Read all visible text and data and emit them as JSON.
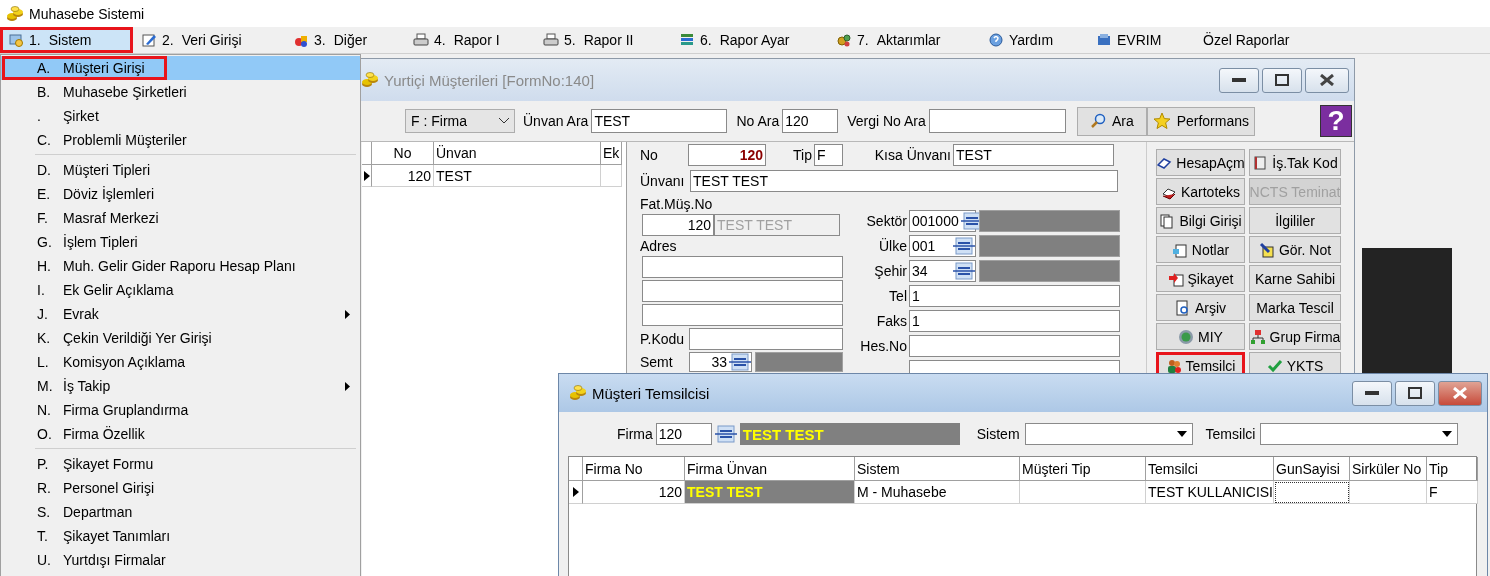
{
  "app": {
    "title": "Muhasebe Sistemi"
  },
  "menu_bar": [
    {
      "number": "1.",
      "label": "Sistem",
      "selected": true,
      "highlighted": true
    },
    {
      "number": "2.",
      "label": "Veri Girişi",
      "selected": false,
      "highlighted": false
    },
    {
      "number": "3.",
      "label": "Diğer",
      "selected": false,
      "highlighted": false
    },
    {
      "number": "4.",
      "label": "Rapor I",
      "selected": false,
      "highlighted": false
    },
    {
      "number": "5.",
      "label": "Rapor II",
      "selected": false,
      "highlighted": false
    },
    {
      "number": "6.",
      "label": "Rapor Ayar",
      "selected": false,
      "highlighted": false
    },
    {
      "number": "7.",
      "label": "Aktarımlar",
      "selected": false,
      "highlighted": false
    },
    {
      "label": "Yardım",
      "selected": false,
      "highlighted": false
    },
    {
      "label": "EVRIM",
      "selected": false,
      "highlighted": false
    },
    {
      "label": "Özel Raporlar",
      "selected": false,
      "highlighted": false
    }
  ],
  "menu_dropdown": {
    "groups": [
      {
        "items": [
          {
            "key": "A.",
            "label": "Müşteri Girişi",
            "selected": true,
            "highlighted": true,
            "submenu": false
          },
          {
            "key": "B.",
            "label": "Muhasebe Şirketleri",
            "selected": false,
            "highlighted": false,
            "submenu": false
          },
          {
            "key": ".",
            "label": "Şirket",
            "selected": false,
            "highlighted": false,
            "submenu": false
          },
          {
            "key": "C.",
            "label": "Problemli Müşteriler",
            "selected": false,
            "highlighted": false,
            "submenu": false
          }
        ]
      },
      {
        "items": [
          {
            "key": "D.",
            "label": "Müşteri Tipleri",
            "selected": false,
            "highlighted": false,
            "submenu": false
          },
          {
            "key": "E.",
            "label": "Döviz İşlemleri",
            "selected": false,
            "highlighted": false,
            "submenu": false
          },
          {
            "key": "F.",
            "label": "Masraf Merkezi",
            "selected": false,
            "highlighted": false,
            "submenu": false
          },
          {
            "key": "G.",
            "label": "İşlem Tipleri",
            "selected": false,
            "highlighted": false,
            "submenu": false
          },
          {
            "key": "H.",
            "label": "Muh. Gelir Gider Raporu Hesap Planı",
            "selected": false,
            "highlighted": false,
            "submenu": false
          },
          {
            "key": "I.",
            "label": "Ek Gelir Açıklama",
            "selected": false,
            "highlighted": false,
            "submenu": false
          },
          {
            "key": "J.",
            "label": "Evrak",
            "selected": false,
            "highlighted": false,
            "submenu": true
          },
          {
            "key": "K.",
            "label": "Çekin Verildiği Yer Girişi",
            "selected": false,
            "highlighted": false,
            "submenu": false
          },
          {
            "key": "L.",
            "label": "Komisyon Açıklama",
            "selected": false,
            "highlighted": false,
            "submenu": false
          },
          {
            "key": "M.",
            "label": "İş Takip",
            "selected": false,
            "highlighted": false,
            "submenu": true
          },
          {
            "key": "N.",
            "label": "Firma Gruplandırma",
            "selected": false,
            "highlighted": false,
            "submenu": false
          },
          {
            "key": "O.",
            "label": "Firma Özellik",
            "selected": false,
            "highlighted": false,
            "submenu": false
          }
        ]
      },
      {
        "items": [
          {
            "key": "P.",
            "label": "Şikayet Formu",
            "selected": false,
            "highlighted": false,
            "submenu": false
          },
          {
            "key": "R.",
            "label": "Personel Girişi",
            "selected": false,
            "highlighted": false,
            "submenu": false
          },
          {
            "key": "S.",
            "label": "Departman",
            "selected": false,
            "highlighted": false,
            "submenu": false
          },
          {
            "key": "T.",
            "label": "Şikayet Tanımları",
            "selected": false,
            "highlighted": false,
            "submenu": false
          },
          {
            "key": "U.",
            "label": "Yurtdışı Firmalar",
            "selected": false,
            "highlighted": false,
            "submenu": false
          }
        ]
      }
    ]
  },
  "customer_window": {
    "title": "Yurtiçi Müşterileri [FormNo:140]",
    "active": false,
    "type_select": "F : Firma",
    "search_fields": [
      {
        "label": "Ünvan Ara",
        "value": "TEST"
      },
      {
        "label": "No Ara",
        "value": "120"
      },
      {
        "label": "Vergi No Ara"
      }
    ],
    "buttons": [
      "Ara",
      "Performans"
    ],
    "help": "?",
    "list": {
      "columns": [
        "No",
        "Ünvan",
        "Ek"
      ],
      "rows": [
        {
          "no": "120",
          "unvan": "TEST",
          "selected": true
        }
      ]
    },
    "form": {
      "no": {
        "label": "No",
        "value": "120"
      },
      "tip": {
        "label": "Tip",
        "value": "F"
      },
      "kisa_unvani": {
        "label": "Kısa Ünvanı",
        "value": "TEST"
      },
      "unvani": {
        "label": "Ünvanı",
        "value": "TEST TEST"
      },
      "fat_mus_no": {
        "label": "Fat.Müş.No",
        "value": "120",
        "name": "TEST TEST"
      },
      "adres": {
        "label": "Adres"
      },
      "p_kodu": {
        "label": "P.Kodu"
      },
      "semt": {
        "label": "Semt",
        "value": "33"
      },
      "right_fields": [
        {
          "kind": "lookup",
          "label": "Sektör",
          "value": "001000"
        },
        {
          "kind": "lookup",
          "label": "Ülke",
          "value": "001"
        },
        {
          "kind": "lookup",
          "label": "Şehir",
          "value": "34"
        },
        {
          "kind": "text",
          "label": "Tel",
          "value": "1"
        },
        {
          "kind": "text",
          "label": "Faks",
          "value": "1"
        },
        {
          "kind": "text",
          "label": "Hes.No"
        },
        {
          "kind": "text"
        }
      ]
    },
    "side_buttons": [
      {
        "label": "HesapAçm",
        "disabled": false,
        "highlighted": false
      },
      {
        "label": "İş.Tak Kod",
        "disabled": false,
        "highlighted": false
      },
      {
        "label": "Kartoteks",
        "disabled": false,
        "highlighted": false
      },
      {
        "label": "NCTS Teminat",
        "disabled": true,
        "highlighted": false
      },
      {
        "label": "Bilgi Girişi",
        "disabled": false,
        "highlighted": false
      },
      {
        "label": "İlgililer",
        "disabled": false,
        "highlighted": false
      },
      {
        "label": "Notlar",
        "disabled": false,
        "highlighted": false
      },
      {
        "label": "Gör. Not",
        "disabled": false,
        "highlighted": false
      },
      {
        "label": "Şikayet",
        "disabled": false,
        "highlighted": false
      },
      {
        "label": "Karne Sahibi",
        "disabled": false,
        "highlighted": false
      },
      {
        "label": "Arşiv",
        "disabled": false,
        "highlighted": false
      },
      {
        "label": "Marka Tescil",
        "disabled": false,
        "highlighted": false
      },
      {
        "label": "MIY",
        "disabled": false,
        "highlighted": false
      },
      {
        "label": "Grup Firma",
        "disabled": false,
        "highlighted": false
      },
      {
        "label": "Temsilci",
        "disabled": false,
        "highlighted": true
      },
      {
        "label": "YKTS",
        "disabled": false,
        "highlighted": false
      }
    ]
  },
  "representative_dialog": {
    "title": "Müşteri Temsilcisi",
    "active": true,
    "firma": {
      "label": "Firma",
      "value": "120",
      "name": "TEST TEST"
    },
    "selects": [
      {
        "label": "Sistem"
      },
      {
        "label": "Temsilci"
      }
    ],
    "columns": [
      "Firma No",
      "Firma Ünvan",
      "Sistem",
      "Müşteri Tip",
      "Temsilci",
      "GunSayisi",
      "Sirküler No",
      "Tip"
    ],
    "rows": [
      {
        "selected": true,
        "cells": [
          {
            "kind": "number",
            "text": "120",
            "focused": false
          },
          {
            "kind": "lookup",
            "text": "TEST TEST",
            "focused": false
          },
          {
            "kind": "text",
            "text": "M - Muhasebe",
            "focused": false
          },
          {
            "kind": "text",
            "focused": false
          },
          {
            "kind": "text",
            "text": "TEST KULLANICISI",
            "focused": false
          },
          {
            "kind": "text",
            "focused": true
          },
          {
            "kind": "text",
            "focused": false
          },
          {
            "kind": "text",
            "text": "F",
            "focused": false
          }
        ]
      }
    ]
  }
}
